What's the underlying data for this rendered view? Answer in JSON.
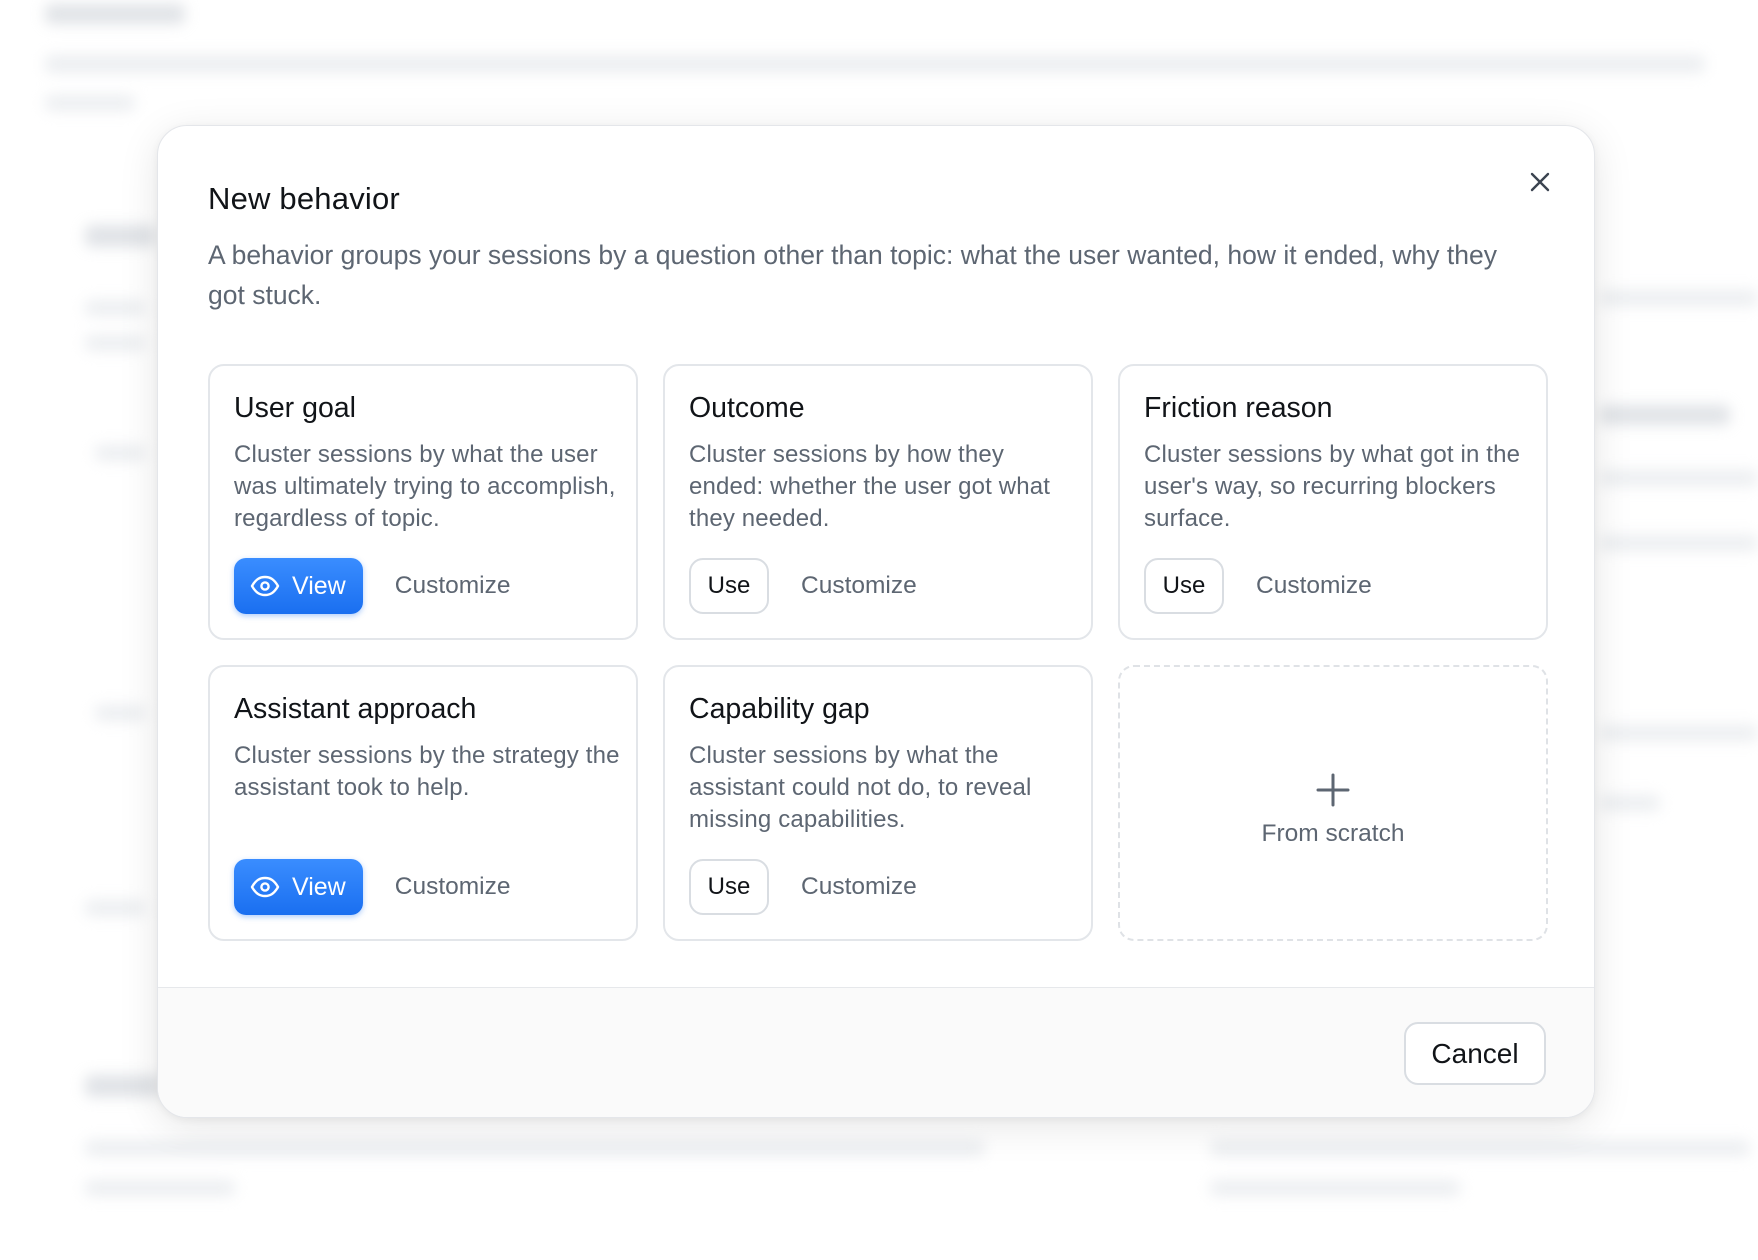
{
  "modal": {
    "title": "New behavior",
    "description": "A behavior groups your sessions by a question other than topic: what the user wanted, how it ended, why they got stuck.",
    "close_icon": "close-icon"
  },
  "cards": [
    {
      "title": "User goal",
      "description": "Cluster sessions by what the user was ultimately trying to accomplish, regardless of topic.",
      "primary_action": "View",
      "primary_icon": "eye-icon",
      "secondary_action": "Customize"
    },
    {
      "title": "Outcome",
      "description": "Cluster sessions by how they ended: whether the user got what they needed.",
      "primary_action": "Use",
      "secondary_action": "Customize"
    },
    {
      "title": "Friction reason",
      "description": "Cluster sessions by what got in the user's way, so recurring blockers surface.",
      "primary_action": "Use",
      "secondary_action": "Customize"
    },
    {
      "title": "Assistant approach",
      "description": "Cluster sessions by the strategy the assistant took to help.",
      "primary_action": "View",
      "primary_icon": "eye-icon",
      "secondary_action": "Customize"
    },
    {
      "title": "Capability gap",
      "description": "Cluster sessions by what the assistant could not do, to reveal missing capabilities.",
      "primary_action": "Use",
      "secondary_action": "Customize"
    }
  ],
  "scratch": {
    "label": "From scratch",
    "icon": "plus-icon"
  },
  "footer": {
    "cancel_label": "Cancel"
  },
  "colors": {
    "accent": "#1a6ff0",
    "text_primary": "#111418",
    "text_secondary": "#5d6672",
    "border": "#e3e6ea"
  }
}
